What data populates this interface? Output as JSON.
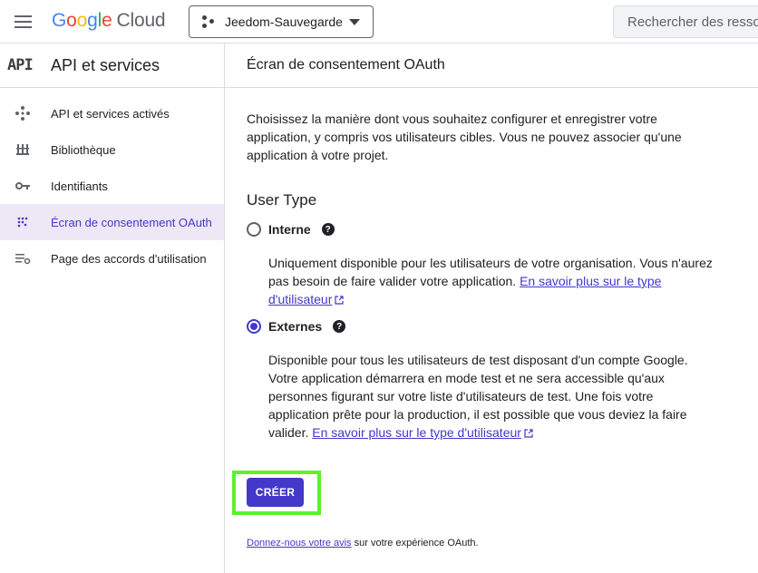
{
  "topbar": {
    "logo": {
      "g1": "G",
      "g2": "o",
      "g3": "o",
      "g4": "g",
      "g5": "l",
      "g6": "e",
      "cloud": "Cloud"
    },
    "project_name": "Jeedom-Sauvegarde",
    "search_placeholder": "Rechercher des ressources"
  },
  "sidebar": {
    "badge": "API",
    "title": "API et services",
    "items": [
      {
        "label": "API et services activés",
        "icon": "api-diamond-icon"
      },
      {
        "label": "Bibliothèque",
        "icon": "library-icon"
      },
      {
        "label": "Identifiants",
        "icon": "key-icon"
      },
      {
        "label": "Écran de consentement OAuth",
        "icon": "consent-dots-icon",
        "active": true
      },
      {
        "label": "Page des accords d'utilisation",
        "icon": "settings-list-icon"
      }
    ]
  },
  "main": {
    "title": "Écran de consentement OAuth",
    "intro": "Choisissez la manière dont vous souhaitez configurer et enregistrer votre application, y compris vos utilisateurs cibles. Vous ne pouvez associer qu'une application à votre projet.",
    "user_type_title": "User Type",
    "options": [
      {
        "label": "Interne",
        "checked": false,
        "desc": "Uniquement disponible pour les utilisateurs de votre organisation. Vous n'aurez pas besoin de faire valider votre application. ",
        "link": "En savoir plus sur le type d'utilisateur"
      },
      {
        "label": "Externes",
        "checked": true,
        "desc": "Disponible pour tous les utilisateurs de test disposant d'un compte Google. Votre application démarrera en mode test et ne sera accessible qu'aux personnes figurant sur votre liste d'utilisateurs de test. Une fois votre application prête pour la production, il est possible que vous deviez la faire valider. ",
        "link": "En savoir plus sur le type d'utilisateur"
      }
    ],
    "help_glyph": "?",
    "create_label": "CRÉER",
    "feedback_link": "Donnez-nous votre avis",
    "feedback_text": " sur votre expérience OAuth."
  },
  "colors": {
    "accent": "#4338ca",
    "active_bg": "#ede7f6",
    "highlight": "#5ef02a"
  }
}
